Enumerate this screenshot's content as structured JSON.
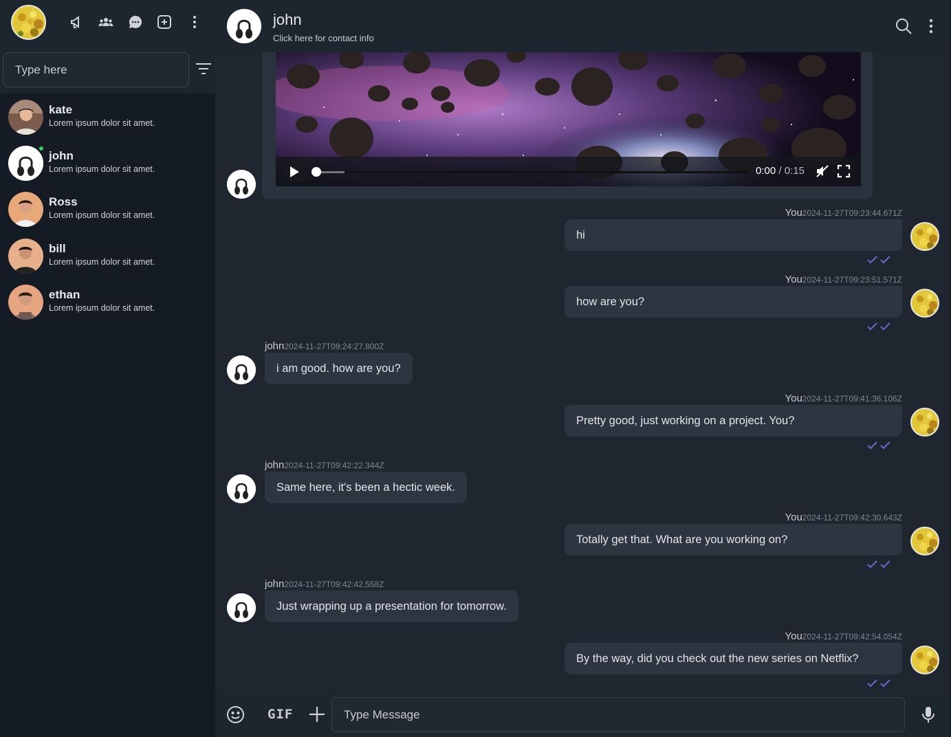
{
  "sidebar": {
    "search_placeholder": "Type here",
    "icons": [
      "megaphone-icon",
      "community-icon",
      "chat-bubble-icon",
      "new-chat-icon",
      "more-vertical-icon"
    ],
    "contacts": [
      {
        "name": "kate",
        "preview": "Lorem ipsum dolor sit amet.",
        "online": false
      },
      {
        "name": "john",
        "preview": "Lorem ipsum dolor sit amet.",
        "online": true
      },
      {
        "name": "Ross",
        "preview": "Lorem ipsum dolor sit amet.",
        "online": false
      },
      {
        "name": "bill",
        "preview": "Lorem ipsum dolor sit amet.",
        "online": false
      },
      {
        "name": "ethan",
        "preview": "Lorem ipsum dolor sit amet.",
        "online": false
      }
    ]
  },
  "header": {
    "name": "john",
    "subtitle": "Click here for contact info"
  },
  "video": {
    "current": "0:00",
    "duration": "0:15",
    "progress": 0
  },
  "messages": [
    {
      "from": "You",
      "time": "2024-11-27T09:23:44.671Z",
      "text": "hi",
      "outgoing": true
    },
    {
      "from": "You",
      "time": "2024-11-27T09:23:51.571Z",
      "text": "how are you?",
      "outgoing": true
    },
    {
      "from": "john",
      "time": "2024-11-27T09:24:27.800Z",
      "text": "i am good. how are you?",
      "outgoing": false
    },
    {
      "from": "You",
      "time": "2024-11-27T09:41:36.106Z",
      "text": "Pretty good, just working on a project. You?",
      "outgoing": true
    },
    {
      "from": "john",
      "time": "2024-11-27T09:42:22.344Z",
      "text": "Same here, it's been a hectic week.",
      "outgoing": false
    },
    {
      "from": "You",
      "time": "2024-11-27T09:42:30.643Z",
      "text": "Totally get that. What are you working on?",
      "outgoing": true
    },
    {
      "from": "john",
      "time": "2024-11-27T09:42:42.558Z",
      "text": "Just wrapping up a presentation for tomorrow.",
      "outgoing": false
    },
    {
      "from": "You",
      "time": "2024-11-27T09:42:54.054Z",
      "text": "By the way, did you check out the new series on Netflix?",
      "outgoing": true
    }
  ],
  "composer": {
    "gif_label": "GIF",
    "placeholder": "Type Message"
  },
  "colors": {
    "background": "#1f2630",
    "sidebar": "#141b24",
    "header": "#1d252f",
    "bubble": "#2d3540",
    "read_ticks": "#6b63c4",
    "online": "#2fcf63"
  }
}
